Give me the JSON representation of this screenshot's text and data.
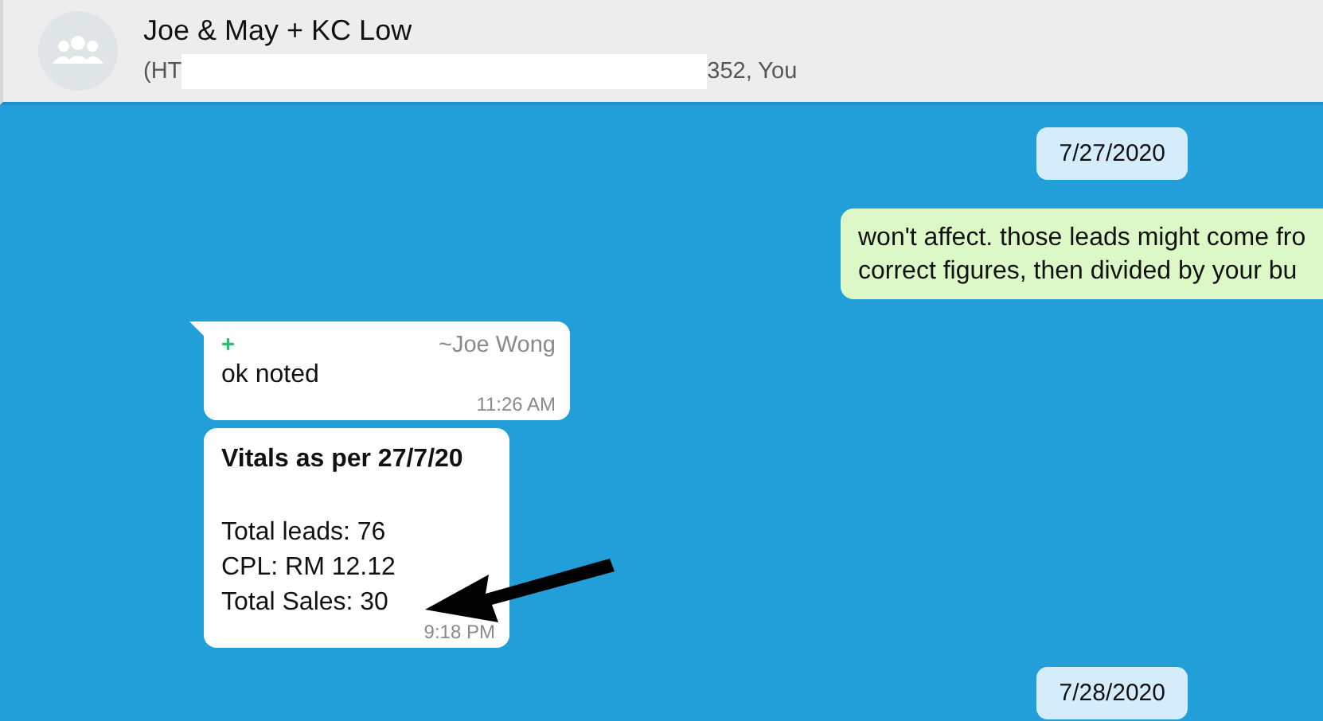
{
  "header": {
    "title": "Joe & May + KC Low",
    "subtitle_parts": [
      "(HT",
      "352, You"
    ]
  },
  "messages": [
    {
      "kind": "date",
      "text": "7/27/2020"
    },
    {
      "kind": "outgoing",
      "lines": [
        "won't affect. those leads might come fro",
        "correct figures, then divided by your bu"
      ]
    },
    {
      "kind": "incoming",
      "tail": true,
      "sender_number": "+",
      "sender": "~Joe Wong",
      "lines": [
        "ok noted"
      ],
      "time": "11:26 AM"
    },
    {
      "kind": "incoming",
      "tail": false,
      "title": "Vitals as per 27/7/20",
      "lines": [
        "Total leads: 76",
        "CPL: RM 12.12",
        "Total Sales: 30"
      ],
      "time": "9:18 PM"
    },
    {
      "kind": "date",
      "text": "7/28/2020"
    }
  ]
}
